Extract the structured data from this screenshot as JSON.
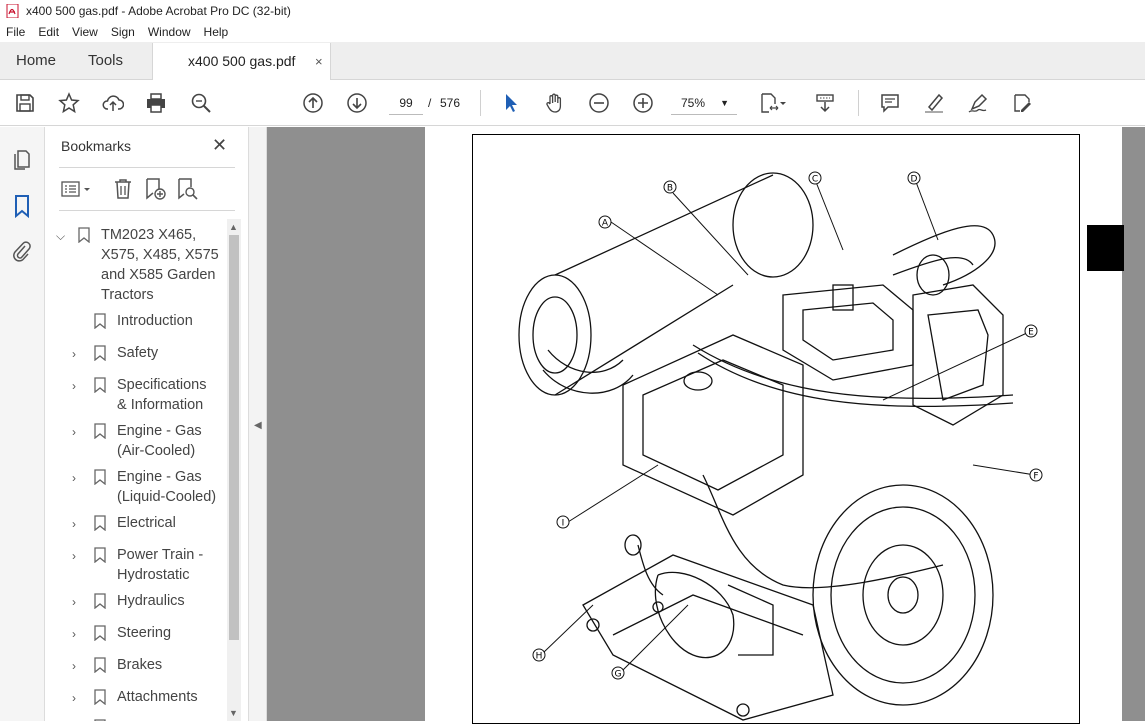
{
  "window": {
    "title": "x400 500 gas.pdf - Adobe Acrobat Pro DC (32-bit)"
  },
  "menu": [
    "File",
    "Edit",
    "View",
    "Sign",
    "Window",
    "Help"
  ],
  "tabs": {
    "home": "Home",
    "tools": "Tools",
    "document": "x400 500 gas.pdf",
    "close": "×"
  },
  "toolbar": {
    "page_current": "99",
    "page_sep": "/",
    "page_total": "576",
    "zoom": "75%"
  },
  "bookmarks": {
    "title": "Bookmarks",
    "close": "✕",
    "items": [
      {
        "label_lines": [
          "TM2023 X465,",
          "X575, X485, X575",
          "and X585 Garden",
          "Tractors"
        ],
        "expanded": true
      },
      {
        "label_lines": [
          "Introduction"
        ]
      },
      {
        "label_lines": [
          "Safety"
        ]
      },
      {
        "label_lines": [
          "Specifications",
          "& Information"
        ]
      },
      {
        "label_lines": [
          "Engine - Gas",
          "(Air-Cooled)"
        ]
      },
      {
        "label_lines": [
          "Engine - Gas",
          "(Liquid-Cooled)"
        ]
      },
      {
        "label_lines": [
          "Electrical"
        ]
      },
      {
        "label_lines": [
          "Power Train -",
          "Hydrostatic"
        ]
      },
      {
        "label_lines": [
          "Hydraulics"
        ]
      },
      {
        "label_lines": [
          "Steering"
        ]
      },
      {
        "label_lines": [
          "Brakes"
        ]
      },
      {
        "label_lines": [
          "Attachments"
        ]
      }
    ]
  },
  "figure": {
    "callouts": [
      "A",
      "B",
      "C",
      "D",
      "E",
      "F",
      "G",
      "H",
      "I"
    ]
  }
}
